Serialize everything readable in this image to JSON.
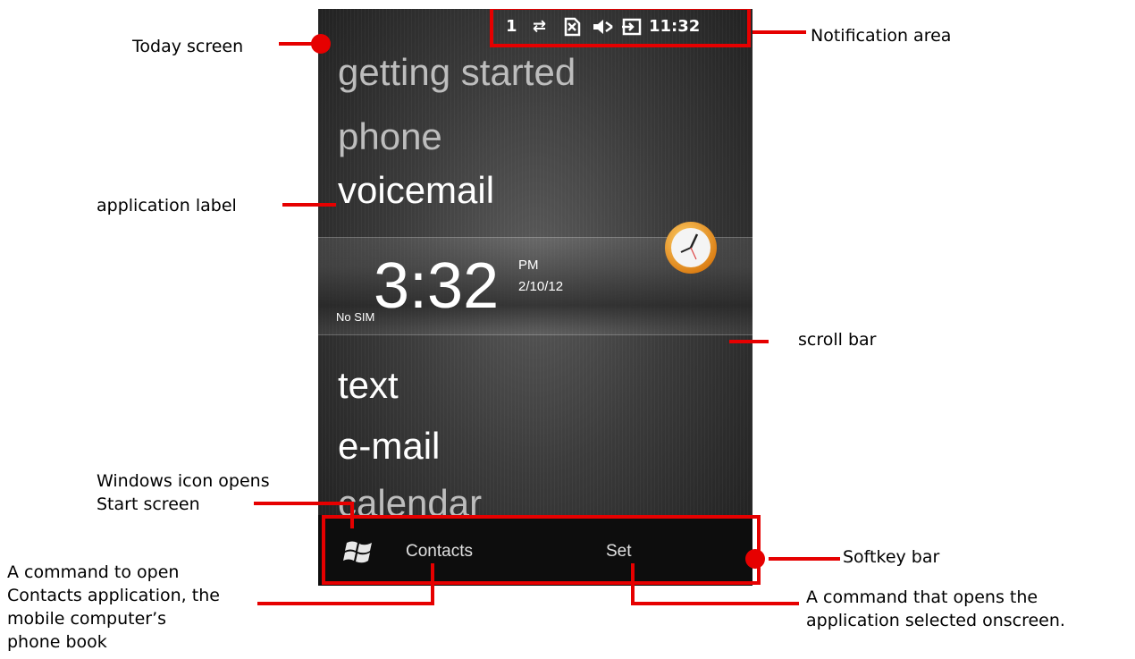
{
  "status": {
    "signal_text": "1",
    "time": "11:32"
  },
  "menu": {
    "items": [
      {
        "label": "getting started"
      },
      {
        "label": "phone"
      },
      {
        "label": "voicemail"
      },
      {
        "label": "text"
      },
      {
        "label": "e-mail"
      },
      {
        "label": "calendar"
      }
    ]
  },
  "clock": {
    "time": "3:32",
    "ampm": "PM",
    "date": "2/10/12",
    "sim": "No SIM"
  },
  "softkeys": {
    "left": "Contacts",
    "right": "Set"
  },
  "annotations": {
    "today_screen": "Today screen",
    "notification_area": "Notification area",
    "application_label": "application label",
    "scroll_bar": "scroll bar",
    "windows_icon_1": "Windows icon opens",
    "windows_icon_2": "Start screen",
    "softkey_bar": "Softkey bar",
    "contacts_cmd_1": "A command to open",
    "contacts_cmd_2": "Contacts application, the",
    "contacts_cmd_3": "mobile computer’s",
    "contacts_cmd_4": "phone book",
    "set_cmd_1": "A command that opens the",
    "set_cmd_2": "application selected onscreen."
  },
  "colors": {
    "annotation_red": "#e60000"
  }
}
